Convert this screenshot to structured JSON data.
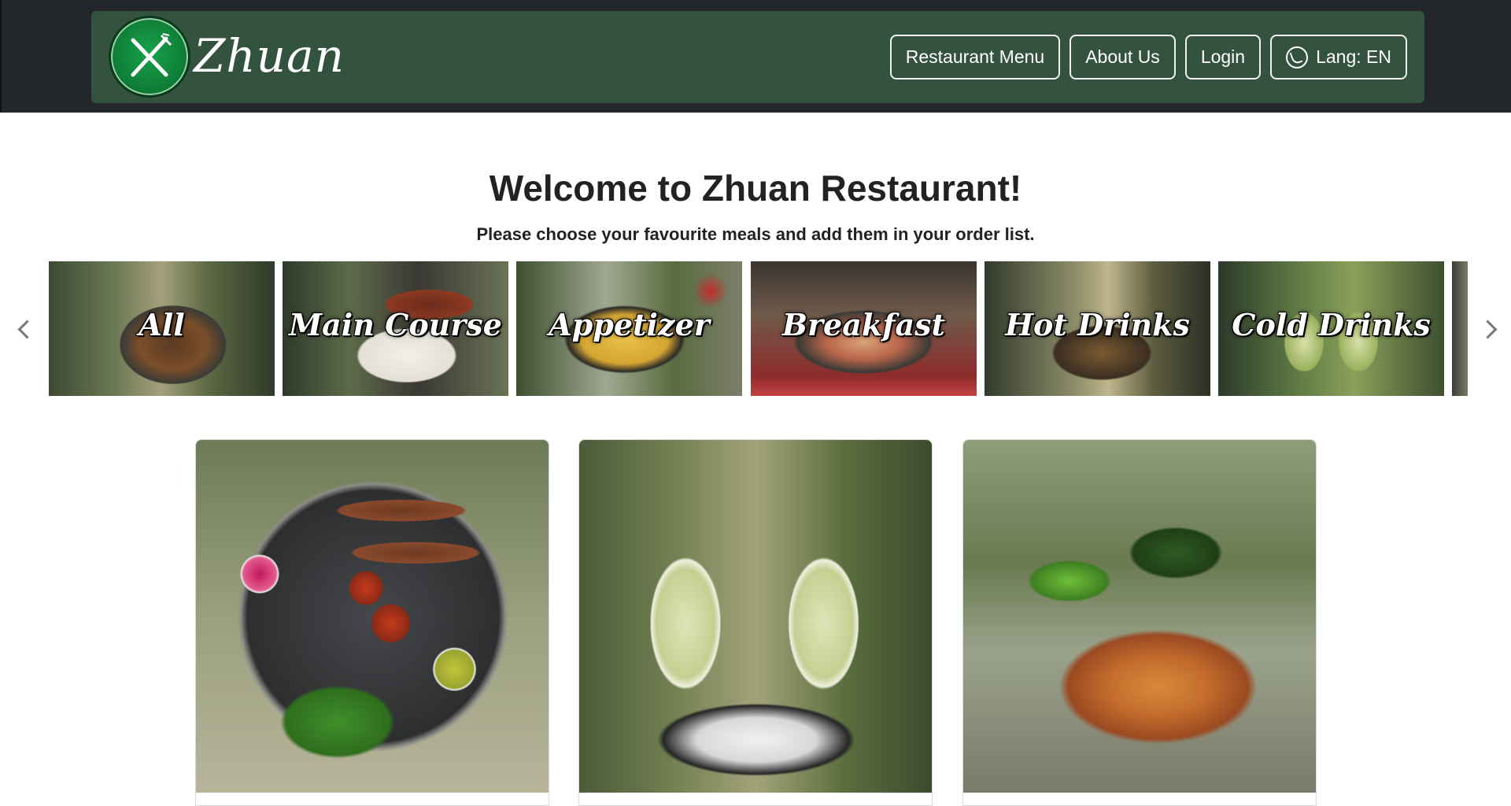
{
  "brand": {
    "name": "Zhuan"
  },
  "nav": {
    "items": [
      {
        "label": "Restaurant Menu"
      },
      {
        "label": "About Us"
      },
      {
        "label": "Login"
      },
      {
        "label": "Lang: EN",
        "icon": "globe-icon"
      }
    ]
  },
  "hero": {
    "title": "Welcome to Zhuan Restaurant!",
    "subtitle": "Please choose your favourite meals and add them in your order list."
  },
  "categories": [
    {
      "label": "All"
    },
    {
      "label": "Main Course"
    },
    {
      "label": "Appetizer"
    },
    {
      "label": "Breakfast"
    },
    {
      "label": "Hot Drinks"
    },
    {
      "label": "Cold Drinks"
    }
  ],
  "carousel": {
    "prev_icon": "chevron-left-icon",
    "next_icon": "chevron-right-icon"
  },
  "colors": {
    "topbar": "#23262a",
    "nav_bg": "#33533f",
    "logo_green": "#0e7a35"
  }
}
